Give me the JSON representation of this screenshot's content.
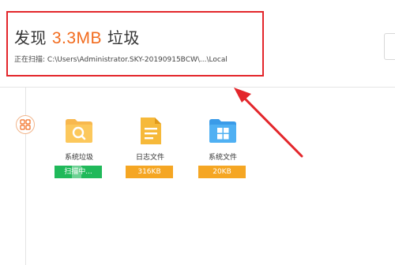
{
  "header": {
    "found_prefix": "发现",
    "found_size": "3.3MB",
    "found_suffix": "垃圾",
    "scan_label": "正在扫描:",
    "scan_path": "C:\\Users\\Administrator.SKY-20190915BCW\\...\\Local"
  },
  "items": [
    {
      "label": "系统垃圾",
      "status": "扫描中...",
      "status_color": "#20b95a",
      "icon": "search-folder-icon"
    },
    {
      "label": "日志文件",
      "status": "316KB",
      "status_color": "#f5a623",
      "icon": "log-file-icon"
    },
    {
      "label": "系统文件",
      "status": "20KB",
      "status_color": "#f5a623",
      "icon": "windows-file-icon"
    }
  ],
  "colors": {
    "accent": "#f26b1d",
    "highlight_box": "#e3262b",
    "scanning": "#20b95a",
    "done": "#f5a623"
  }
}
